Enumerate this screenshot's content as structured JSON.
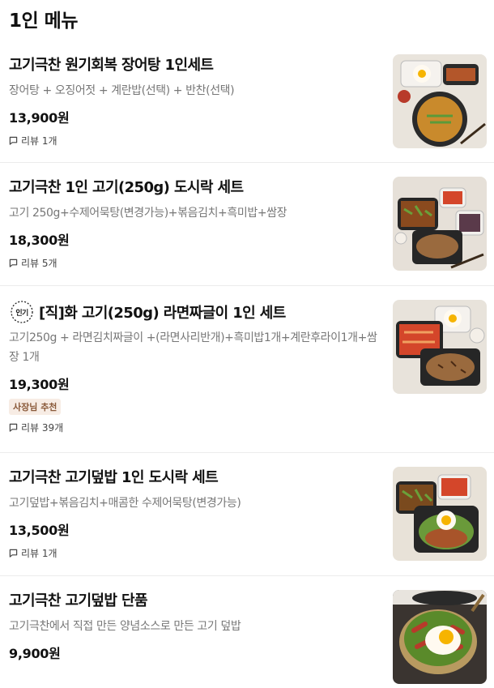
{
  "section": {
    "title": "1인 메뉴"
  },
  "items": [
    {
      "name": "고기극찬 원기회복 장어탕 1인세트",
      "desc": "장어탕 + 오징어젓 + 계란밥(선택) + 반찬(선택)",
      "price": "13,900원",
      "review": "리뷰 1개"
    },
    {
      "name": "고기극찬 1인 고기(250g) 도시락 세트",
      "desc": "고기 250g+수제어묵탕(변경가능)+볶음김치+흑미밥+쌈장",
      "price": "18,300원",
      "review": "리뷰 5개"
    },
    {
      "popular_label": "인기",
      "name": "[직]화 고기(250g) 라면짜글이 1인 세트",
      "desc": "고기250g + 라면김치짜글이 +(라면사리반개)+흑미밥1개+계란후라이1개+쌈장 1개",
      "price": "19,300원",
      "badge": "사장님 추천",
      "review": "리뷰 39개"
    },
    {
      "name": "고기극찬 고기덮밥 1인 도시락 세트",
      "desc": "고기덮밥+볶음김치+매콤한 수제어묵탕(변경가능)",
      "price": "13,500원",
      "review": "리뷰 1개"
    },
    {
      "name": "고기극찬 고기덮밥 단품",
      "desc": "고기극찬에서 직접 만든 양념소스로 만든 고기 덮밥",
      "price": "9,900원"
    }
  ]
}
